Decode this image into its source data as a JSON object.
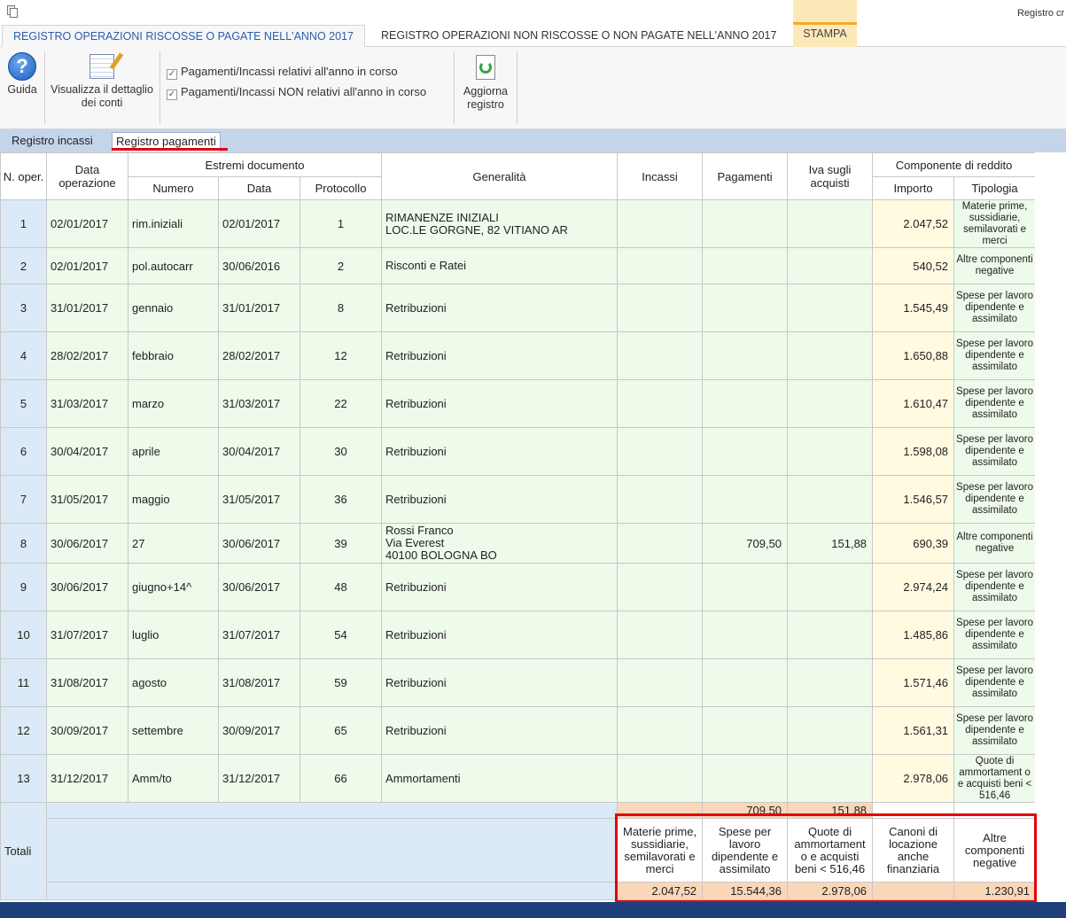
{
  "window": {
    "title": "Registro cr"
  },
  "ribbon_tabs": [
    {
      "label": "REGISTRO OPERAZIONI RISCOSSE O PAGATE NELL'ANNO 2017"
    },
    {
      "label": "REGISTRO OPERAZIONI NON RISCOSSE O NON PAGATE NELL'ANNO 2017"
    },
    {
      "label": "STAMPA"
    }
  ],
  "ribbon": {
    "guida_label": "Guida",
    "visualizza_label": "Visualizza il dettaglio dei conti",
    "check1_label": "Pagamenti/Incassi relativi all'anno in corso",
    "check2_label": "Pagamenti/Incassi NON relativi all'anno in corso",
    "aggiorna_label": "Aggiorna registro",
    "check_mark": "✓"
  },
  "sub_tabs": [
    {
      "label": "Registro incassi"
    },
    {
      "label": "Registro pagamenti"
    }
  ],
  "table": {
    "headers": {
      "n_oper": "N. oper.",
      "data_operazione": "Data operazione",
      "estremi": "Estremi documento",
      "numero": "Numero",
      "data": "Data",
      "protocollo": "Protocollo",
      "generalita": "Generalità",
      "incassi": "Incassi",
      "pagamenti": "Pagamenti",
      "iva": "Iva sugli acquisti",
      "componente": "Componente di reddito",
      "importo": "Importo",
      "tipologia": "Tipologia"
    },
    "rows": [
      {
        "n": "1",
        "data_op": "02/01/2017",
        "numero": "rim.iniziali",
        "data": "02/01/2017",
        "prot": "1",
        "gen": [
          "RIMANENZE INIZIALI",
          "LOC.LE GORGNE, 82 VITIANO AR"
        ],
        "incassi": "",
        "pagamenti": "",
        "iva": "",
        "importo": "2.047,52",
        "tipologia": "Materie prime, sussidiarie, semilavorati e merci"
      },
      {
        "n": "2",
        "data_op": "02/01/2017",
        "numero": "pol.autocarr",
        "data": "30/06/2016",
        "prot": "2",
        "gen": [
          "Risconti e Ratei"
        ],
        "incassi": "",
        "pagamenti": "",
        "iva": "",
        "importo": "540,52",
        "tipologia": "Altre componenti negative"
      },
      {
        "n": "3",
        "data_op": "31/01/2017",
        "numero": "gennaio",
        "data": "31/01/2017",
        "prot": "8",
        "gen": [
          "Retribuzioni"
        ],
        "incassi": "",
        "pagamenti": "",
        "iva": "",
        "importo": "1.545,49",
        "tipologia": "Spese per lavoro dipendente e assimilato"
      },
      {
        "n": "4",
        "data_op": "28/02/2017",
        "numero": "febbraio",
        "data": "28/02/2017",
        "prot": "12",
        "gen": [
          "Retribuzioni"
        ],
        "incassi": "",
        "pagamenti": "",
        "iva": "",
        "importo": "1.650,88",
        "tipologia": "Spese per lavoro dipendente e assimilato"
      },
      {
        "n": "5",
        "data_op": "31/03/2017",
        "numero": "marzo",
        "data": "31/03/2017",
        "prot": "22",
        "gen": [
          "Retribuzioni"
        ],
        "incassi": "",
        "pagamenti": "",
        "iva": "",
        "importo": "1.610,47",
        "tipologia": "Spese per lavoro dipendente e assimilato"
      },
      {
        "n": "6",
        "data_op": "30/04/2017",
        "numero": "aprile",
        "data": "30/04/2017",
        "prot": "30",
        "gen": [
          "Retribuzioni"
        ],
        "incassi": "",
        "pagamenti": "",
        "iva": "",
        "importo": "1.598,08",
        "tipologia": "Spese per lavoro dipendente e assimilato"
      },
      {
        "n": "7",
        "data_op": "31/05/2017",
        "numero": "maggio",
        "data": "31/05/2017",
        "prot": "36",
        "gen": [
          "Retribuzioni"
        ],
        "incassi": "",
        "pagamenti": "",
        "iva": "",
        "importo": "1.546,57",
        "tipologia": "Spese per lavoro dipendente e assimilato"
      },
      {
        "n": "8",
        "data_op": "30/06/2017",
        "numero": "27",
        "data": "30/06/2017",
        "prot": "39",
        "gen": [
          "Rossi Franco",
          "Via Everest",
          "40100 BOLOGNA BO"
        ],
        "incassi": "",
        "pagamenti": "709,50",
        "iva": "151,88",
        "importo": "690,39",
        "tipologia": "Altre componenti negative"
      },
      {
        "n": "9",
        "data_op": "30/06/2017",
        "numero": "giugno+14^",
        "data": "30/06/2017",
        "prot": "48",
        "gen": [
          "Retribuzioni"
        ],
        "incassi": "",
        "pagamenti": "",
        "iva": "",
        "importo": "2.974,24",
        "tipologia": "Spese per lavoro dipendente e assimilato"
      },
      {
        "n": "10",
        "data_op": "31/07/2017",
        "numero": "luglio",
        "data": "31/07/2017",
        "prot": "54",
        "gen": [
          "Retribuzioni"
        ],
        "incassi": "",
        "pagamenti": "",
        "iva": "",
        "importo": "1.485,86",
        "tipologia": "Spese per lavoro dipendente e assimilato"
      },
      {
        "n": "11",
        "data_op": "31/08/2017",
        "numero": "agosto",
        "data": "31/08/2017",
        "prot": "59",
        "gen": [
          "Retribuzioni"
        ],
        "incassi": "",
        "pagamenti": "",
        "iva": "",
        "importo": "1.571,46",
        "tipologia": "Spese per lavoro dipendente e assimilato"
      },
      {
        "n": "12",
        "data_op": "30/09/2017",
        "numero": "settembre",
        "data": "30/09/2017",
        "prot": "65",
        "gen": [
          "Retribuzioni"
        ],
        "incassi": "",
        "pagamenti": "",
        "iva": "",
        "importo": "1.561,31",
        "tipologia": "Spese per lavoro dipendente e assimilato"
      },
      {
        "n": "13",
        "data_op": "31/12/2017",
        "numero": "Amm/to",
        "data": "31/12/2017",
        "prot": "66",
        "gen": [
          "Ammortamenti"
        ],
        "incassi": "",
        "pagamenti": "",
        "iva": "",
        "importo": "2.978,06",
        "tipologia": "Quote di ammortament o e acquisti beni < 516,46"
      }
    ],
    "totals": {
      "label": "Totali",
      "pagamenti": "709,50",
      "iva": "151,88",
      "categories": [
        {
          "label": "Materie prime, sussidiarie, semilavorati e merci",
          "value": "2.047,52"
        },
        {
          "label": "Spese per lavoro dipendente e assimilato",
          "value": "15.544,36"
        },
        {
          "label": "Quote di ammortament o e acquisti beni < 516,46",
          "value": "2.978,06"
        },
        {
          "label": "Canoni di locazione anche finanziaria",
          "value": ""
        },
        {
          "label": "Altre componenti negative",
          "value": "1.230,91"
        }
      ]
    }
  },
  "colors": {
    "row_bg": "#eefaea",
    "importo_bg": "#fffae0",
    "totals_peach": "#f9d7b8",
    "highlight_red": "#e3000f",
    "subtab_bar": "#c4d5eb"
  }
}
